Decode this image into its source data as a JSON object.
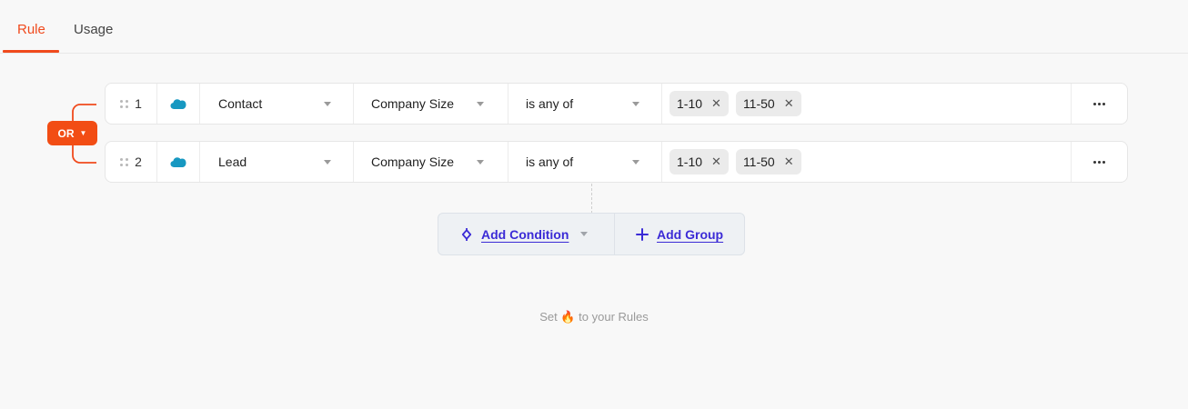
{
  "tabs": [
    {
      "label": "Rule",
      "active": true
    },
    {
      "label": "Usage",
      "active": false
    }
  ],
  "accent_color": "#f04a1d",
  "link_color": "#3b2bd6",
  "logic_operator": {
    "label": "OR",
    "icon": "caret-down-icon"
  },
  "rules": [
    {
      "index": "1",
      "source_icon": "salesforce-cloud-icon",
      "object": "Contact",
      "field": "Company Size",
      "operator": "is any of",
      "values": [
        "1-10",
        "11-50"
      ]
    },
    {
      "index": "2",
      "source_icon": "salesforce-cloud-icon",
      "object": "Lead",
      "field": "Company Size",
      "operator": "is any of",
      "values": [
        "1-10",
        "11-50"
      ]
    }
  ],
  "actions": {
    "add_condition": "Add Condition",
    "add_group": "Add Group"
  },
  "footer": {
    "prefix": "Set",
    "emoji": "🔥",
    "suffix": "to your Rules"
  }
}
